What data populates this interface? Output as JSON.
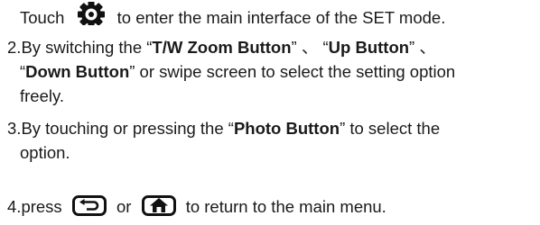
{
  "step1": {
    "prefix": "Touch",
    "icon": "gear-settings-icon",
    "suffix": "to enter the main interface of the SET mode."
  },
  "step2": {
    "num": "2.",
    "text_a": "By switching the “",
    "tw_zoom": "T/W Zoom Button",
    "text_b": "” 、 “",
    "up": "Up Button",
    "text_c": "” 、",
    "text_d": "“",
    "down": "Down Button",
    "text_e": "” or swipe screen to select the setting option",
    "text_f": "freely."
  },
  "step3": {
    "num": "3.",
    "text_a": "By touching or pressing the “",
    "photo": "Photo Button",
    "text_b": "” to select the",
    "text_c": "option."
  },
  "step4": {
    "num": "4.",
    "text_a": "press",
    "back_icon": "back-arrow-icon",
    "or": "or",
    "home_icon": "home-icon",
    "text_b": "to return to the main menu."
  }
}
